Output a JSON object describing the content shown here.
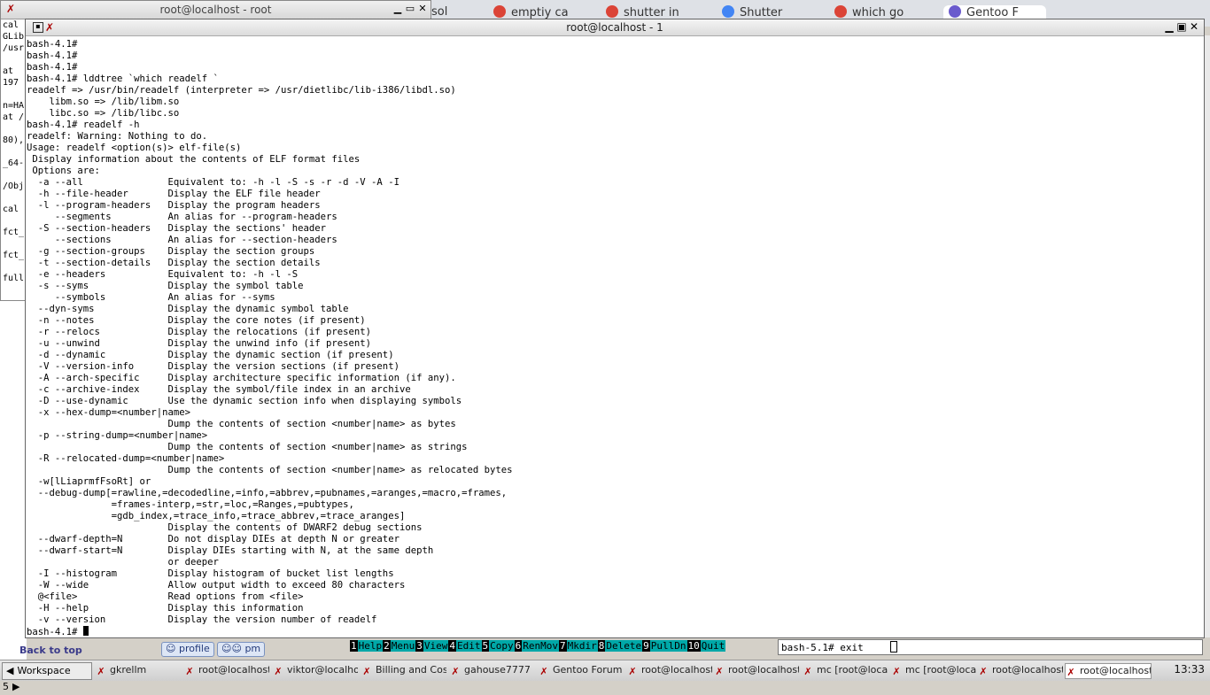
{
  "browser_tabs": [
    {
      "label": "sol",
      "color": "#888888"
    },
    {
      "label": "emptiy ca",
      "color": "#db4437"
    },
    {
      "label": "shutter in",
      "color": "#db4437"
    },
    {
      "label": "Shutter",
      "color": "#4285f4"
    },
    {
      "label": "which go",
      "color": "#db4437"
    },
    {
      "label": "Gentoo F",
      "color": "#6a5acd"
    }
  ],
  "back_window": {
    "title": "root@localhost - root",
    "lines": [
      "cal",
      "GLib",
      "/usr",
      "",
      "at",
      "197",
      "",
      "n=HA",
      "at /",
      "",
      "80),",
      "",
      "_64-",
      "",
      "/Obj",
      "",
      "cal",
      "",
      "fct_",
      "",
      "fct_",
      "",
      "full",
      ""
    ]
  },
  "left_strip": {
    "back_to_top": "Back to top",
    "buttons": [
      "profile",
      "pm"
    ]
  },
  "main_window": {
    "title": "root@localhost - 1",
    "lines": [
      "bash-4.1#",
      "bash-4.1#",
      "bash-4.1#",
      "bash-4.1# lddtree `which readelf `",
      "readelf => /usr/bin/readelf (interpreter => /usr/dietlibc/lib-i386/libdl.so)",
      "    libm.so => /lib/libm.so",
      "    libc.so => /lib/libc.so",
      "bash-4.1# readelf -h",
      "readelf: Warning: Nothing to do.",
      "Usage: readelf <option(s)> elf-file(s)",
      " Display information about the contents of ELF format files",
      " Options are:",
      "  -a --all               Equivalent to: -h -l -S -s -r -d -V -A -I",
      "  -h --file-header       Display the ELF file header",
      "  -l --program-headers   Display the program headers",
      "     --segments          An alias for --program-headers",
      "  -S --section-headers   Display the sections' header",
      "     --sections          An alias for --section-headers",
      "  -g --section-groups    Display the section groups",
      "  -t --section-details   Display the section details",
      "  -e --headers           Equivalent to: -h -l -S",
      "  -s --syms              Display the symbol table",
      "     --symbols           An alias for --syms",
      "  --dyn-syms             Display the dynamic symbol table",
      "  -n --notes             Display the core notes (if present)",
      "  -r --relocs            Display the relocations (if present)",
      "  -u --unwind            Display the unwind info (if present)",
      "  -d --dynamic           Display the dynamic section (if present)",
      "  -V --version-info      Display the version sections (if present)",
      "  -A --arch-specific     Display architecture specific information (if any).",
      "  -c --archive-index     Display the symbol/file index in an archive",
      "  -D --use-dynamic       Use the dynamic section info when displaying symbols",
      "  -x --hex-dump=<number|name>",
      "                         Dump the contents of section <number|name> as bytes",
      "  -p --string-dump=<number|name>",
      "                         Dump the contents of section <number|name> as strings",
      "  -R --relocated-dump=<number|name>",
      "                         Dump the contents of section <number|name> as relocated bytes",
      "  -w[lLiaprmfFsoRt] or",
      "  --debug-dump[=rawline,=decodedline,=info,=abbrev,=pubnames,=aranges,=macro,=frames,",
      "               =frames-interp,=str,=loc,=Ranges,=pubtypes,",
      "               =gdb_index,=trace_info,=trace_abbrev,=trace_aranges]",
      "                         Display the contents of DWARF2 debug sections",
      "  --dwarf-depth=N        Do not display DIEs at depth N or greater",
      "  --dwarf-start=N        Display DIEs starting with N, at the same depth",
      "                         or deeper",
      "  -I --histogram         Display histogram of bucket list lengths",
      "  -W --wide              Allow output width to exceed 80 characters",
      "  @<file>                Read options from <file>",
      "  -H --help              Display this information",
      "  -v --version           Display the version number of readelf"
    ],
    "prompt": "bash-4.1# "
  },
  "mc_keys": [
    {
      "num": "1",
      "label": "Help"
    },
    {
      "num": "2",
      "label": "Menu"
    },
    {
      "num": "3",
      "label": "View"
    },
    {
      "num": "4",
      "label": "Edit"
    },
    {
      "num": "5",
      "label": "Copy"
    },
    {
      "num": "6",
      "label": "RenMov"
    },
    {
      "num": "7",
      "label": "Mkdir"
    },
    {
      "num": "8",
      "label": "Delete"
    },
    {
      "num": "9",
      "label": "PullDn"
    },
    {
      "num": "10",
      "label": "Quit"
    }
  ],
  "small_term": {
    "text": "bash-5.1# exit"
  },
  "taskbar": {
    "workspace": "Workspace 5",
    "items": [
      "gkrellm",
      "root@localhost",
      "viktor@localho",
      "Billing and Cost",
      "gahouse7777",
      "Gentoo Forum",
      "root@localhost",
      "root@localhost",
      "mc [root@local",
      "mc [root@local",
      "root@localhost",
      "root@localhost"
    ],
    "clock": "13:33"
  }
}
